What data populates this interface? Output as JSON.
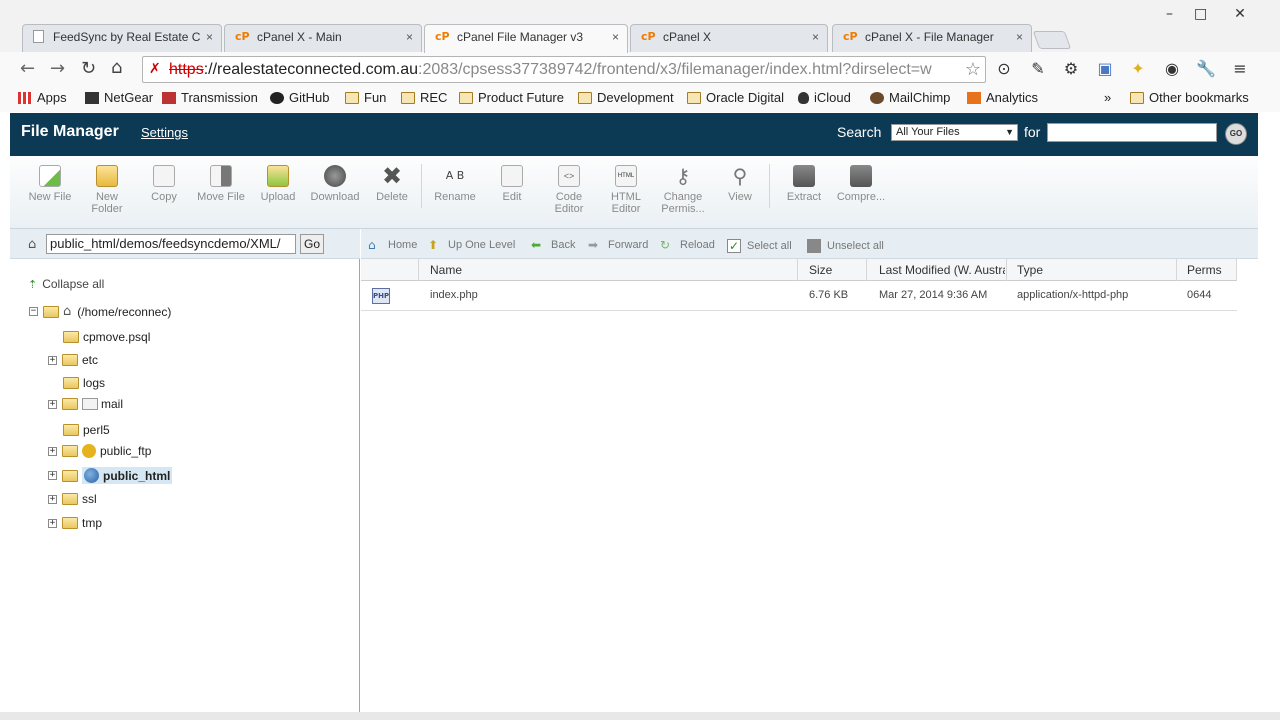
{
  "browser": {
    "tabs": [
      {
        "label": "FeedSync by Real Estate C",
        "icon": "page-icon"
      },
      {
        "label": "cPanel X - Main",
        "icon": "cpanel-icon"
      },
      {
        "label": "cPanel File Manager v3",
        "icon": "cpanel-icon"
      },
      {
        "label": "cPanel X",
        "icon": "cpanel-icon"
      },
      {
        "label": "cPanel X - File Manager",
        "icon": "cpanel-icon"
      }
    ],
    "tab_close": "×",
    "url_scheme": "https",
    "url_host": "://realestateconnected.com.au",
    "url_rest": ":2083/cpsess377389742/frontend/x3/filemanager/index.html?dirselect=w",
    "bookmarks": [
      "Apps",
      "NetGear",
      "Transmission",
      "GitHub",
      "Fun",
      "REC",
      "Product Future",
      "Development",
      "Oracle Digital",
      "iCloud",
      "MailChimp",
      "Analytics"
    ],
    "bookmarks_overflow": "»",
    "other_bookmarks": "Other bookmarks"
  },
  "cpanel": {
    "title": "File Manager",
    "settings": "Settings",
    "search_label": "Search",
    "search_scope": "All Your Files",
    "for_label": "for",
    "go": "GO",
    "toolbar": [
      {
        "label": "New File",
        "icon": "new-file-icon"
      },
      {
        "label": "New Folder",
        "icon": "new-folder-icon"
      },
      {
        "label": "Copy",
        "icon": "copy-icon"
      },
      {
        "label": "Move File",
        "icon": "move-file-icon"
      },
      {
        "label": "Upload",
        "icon": "upload-icon"
      },
      {
        "label": "Download",
        "icon": "download-icon"
      },
      {
        "label": "Delete",
        "icon": "delete-icon"
      },
      {
        "label": "Rename",
        "icon": "rename-icon"
      },
      {
        "label": "Edit",
        "icon": "edit-icon"
      },
      {
        "label": "Code Editor",
        "icon": "code-editor-icon"
      },
      {
        "label": "HTML Editor",
        "icon": "html-editor-icon"
      },
      {
        "label": "Change Permis...",
        "icon": "permissions-icon"
      },
      {
        "label": "View",
        "icon": "view-icon"
      },
      {
        "label": "Extract",
        "icon": "extract-icon"
      },
      {
        "label": "Compre...",
        "icon": "compress-icon"
      }
    ],
    "path_value": "public_html/demos/feedsyncdemo/XML/",
    "path_go": "Go",
    "collapse_all": "Collapse all",
    "tree": {
      "root": "(/home/reconnec)",
      "items": [
        "cpmove.psql",
        "etc",
        "logs",
        "mail",
        "perl5",
        "public_ftp",
        "public_html",
        "ssl",
        "tmp"
      ]
    },
    "actions": [
      "Home",
      "Up One Level",
      "Back",
      "Forward",
      "Reload",
      "Select all",
      "Unselect all"
    ],
    "columns": [
      "Name",
      "Size",
      "Last Modified (W. Australia)",
      "Type",
      "Perms"
    ],
    "files": [
      {
        "icon": "PHP",
        "name": "index.php",
        "size": "6.76 KB",
        "modified": "Mar 27, 2014 9:36 AM",
        "type": "application/x-httpd-php",
        "perms": "0644"
      }
    ]
  }
}
